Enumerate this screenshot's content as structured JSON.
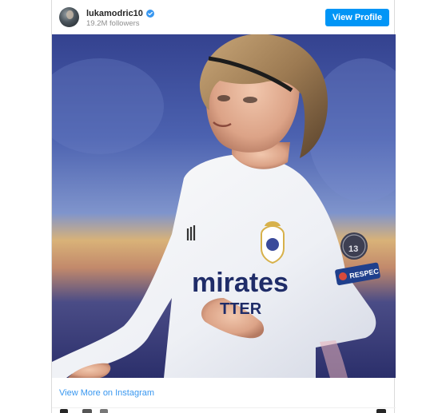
{
  "profile": {
    "username": "lukamodric10",
    "followers": "19.2M followers",
    "view_profile_label": "View Profile",
    "verified_color": "#3897f0",
    "button_color": "#0095f6"
  },
  "photo": {
    "jersey_sponsor": "mirates",
    "jersey_sponsor_line2": "TTER",
    "sleeve_badge_text": "13",
    "sleeve_patch_text": "RESPEC",
    "kit_brand_mark": "adidas-stripes"
  },
  "footer": {
    "view_more_label": "View More on Instagram",
    "link_color": "#3897f0"
  }
}
